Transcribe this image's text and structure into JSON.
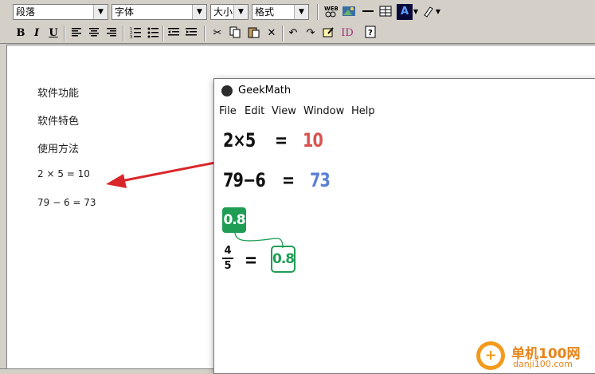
{
  "toolbar": {
    "paragraph_select": "段落",
    "font_select": "字体",
    "size_select": "大小",
    "format_select": "格式",
    "bold": "B",
    "italic": "I",
    "underline": "U"
  },
  "editor": {
    "lines": [
      "软件功能",
      "软件特色",
      "使用方法",
      "2 × 5 = 10",
      "79 − 6 = 73"
    ]
  },
  "geekmath": {
    "title": "GeekMath",
    "menu": [
      "File",
      "Edit",
      "View",
      "Window",
      "Help"
    ],
    "expr1_left": "2×5",
    "expr1_eq": "=",
    "expr1_result": "10",
    "expr2_left": "79−6",
    "expr2_eq": "=",
    "expr2_result": "73",
    "badge_value": "0.8",
    "fraction_num": "4",
    "fraction_den": "5",
    "expr3_eq": "=",
    "expr3_result": "0.8",
    "colors": {
      "result1": "#d9534f",
      "result2": "#5b7fd6",
      "green": "#1f9d55",
      "arrow": "#d9262a"
    }
  },
  "watermark": {
    "line1": "单机100网",
    "line2": "danji100.com"
  }
}
